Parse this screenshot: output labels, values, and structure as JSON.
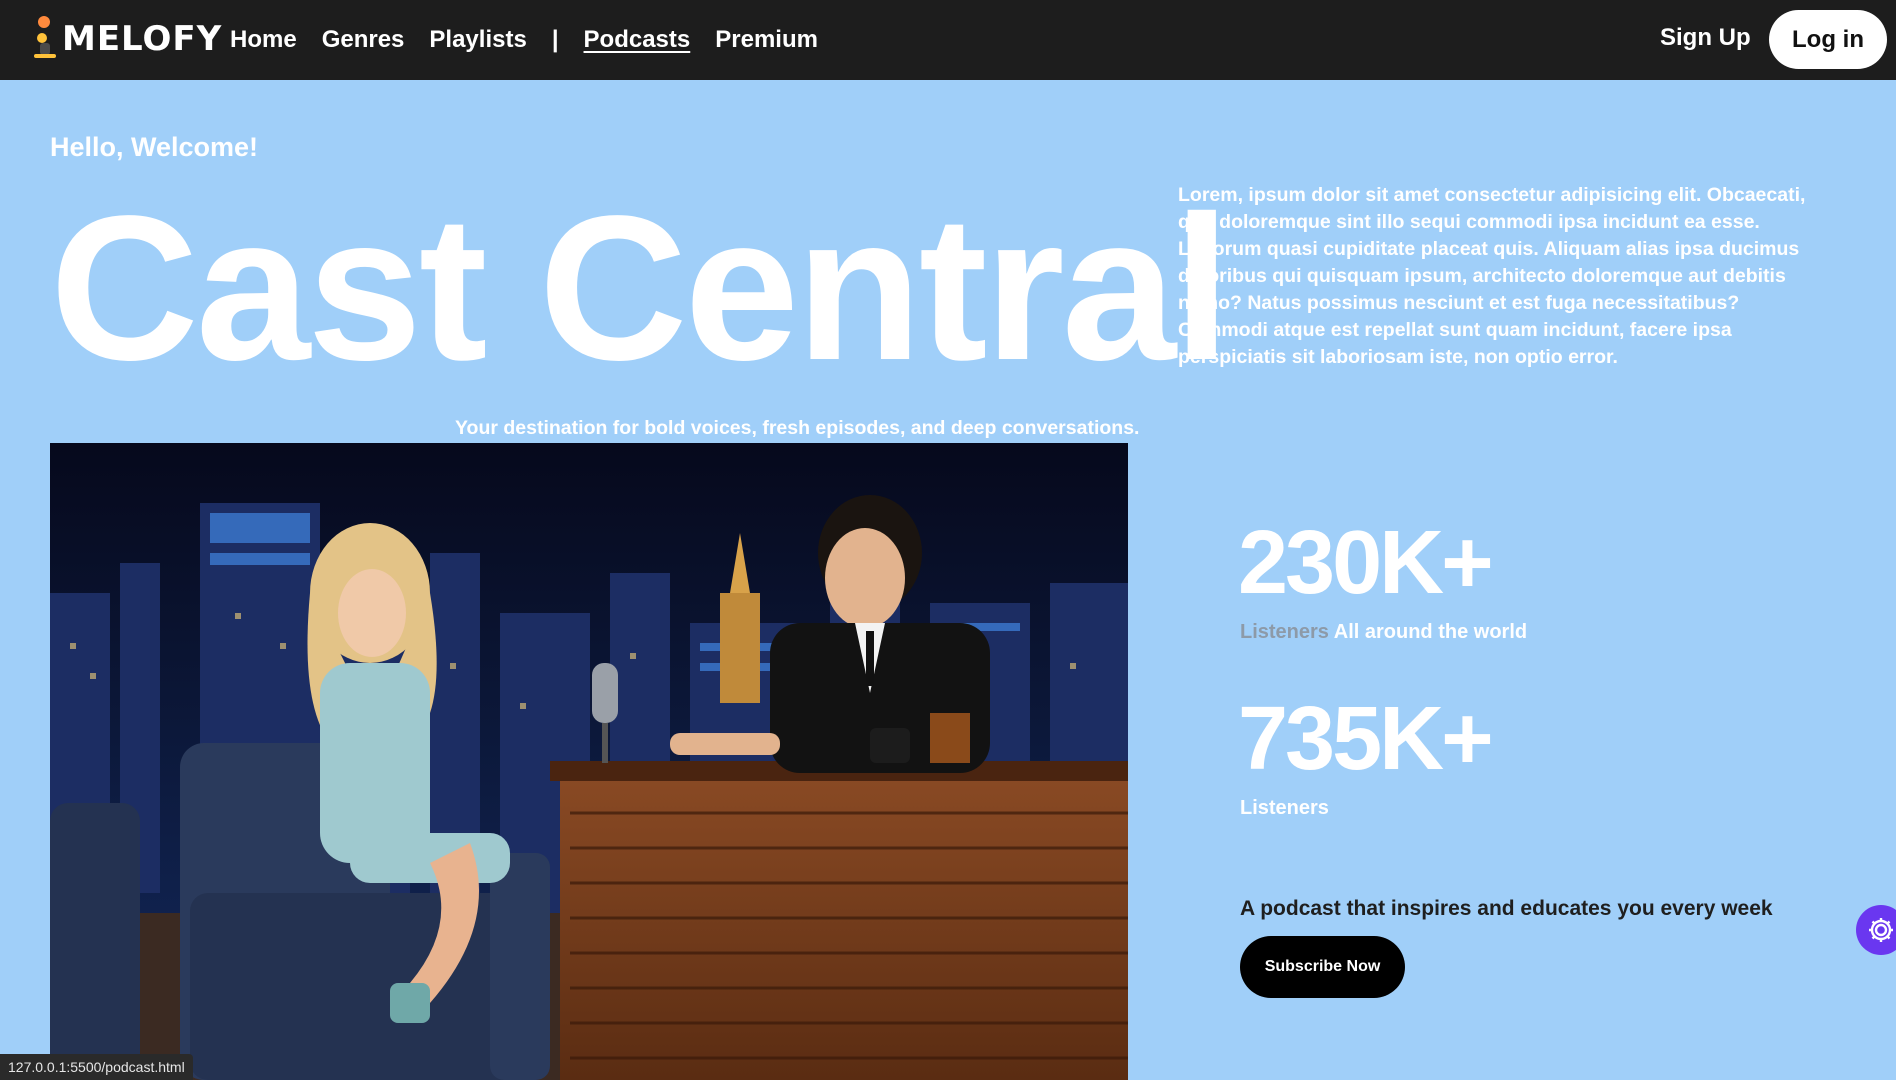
{
  "header": {
    "logo_text": "MELOFY",
    "nav": {
      "home": "Home",
      "genres": "Genres",
      "playlists": "Playlists",
      "separator": "|",
      "podcasts": "Podcasts",
      "premium": "Premium"
    },
    "active_nav": "Podcasts",
    "signup": "Sign Up",
    "login": "Log in"
  },
  "hero": {
    "greeting": "Hello, Welcome!",
    "title": "Cast Central",
    "intro": "Lorem, ipsum dolor sit amet consectetur adipisicing elit. Obcaecati, quo doloremque sint illo sequi commodi ipsa incidunt ea esse. Laborum quasi cupiditate placeat quis. Aliquam alias ipsa ducimus doloribus qui quisquam ipsum, architecto doloremque aut debitis nemo? Natus possimus nesciunt et est fuga necessitatibus? Commodi atque est repellat sunt quam incidunt, facere ipsa perspiciatis sit laboriosam iste, non optio error.",
    "tagline": "Your destination for bold voices, fresh episodes, and deep conversations."
  },
  "stats": [
    {
      "value": "230K+",
      "label_muted": "Listeners",
      "label_rest": "All around the world"
    },
    {
      "value": "735K+",
      "label_muted": "",
      "label_rest": "Listeners"
    }
  ],
  "cta": {
    "weekly": "A podcast that inspires and educates you every week",
    "subscribe": "Subscribe Now"
  },
  "status_url": "127.0.0.1:5500/podcast.html",
  "icons": {
    "logo_mark": "mascot-icon",
    "fab": "gear-icon"
  },
  "colors": {
    "background": "#a0cff9",
    "topbar": "#1d1d1d",
    "accent_fab": "#6a37f0"
  }
}
